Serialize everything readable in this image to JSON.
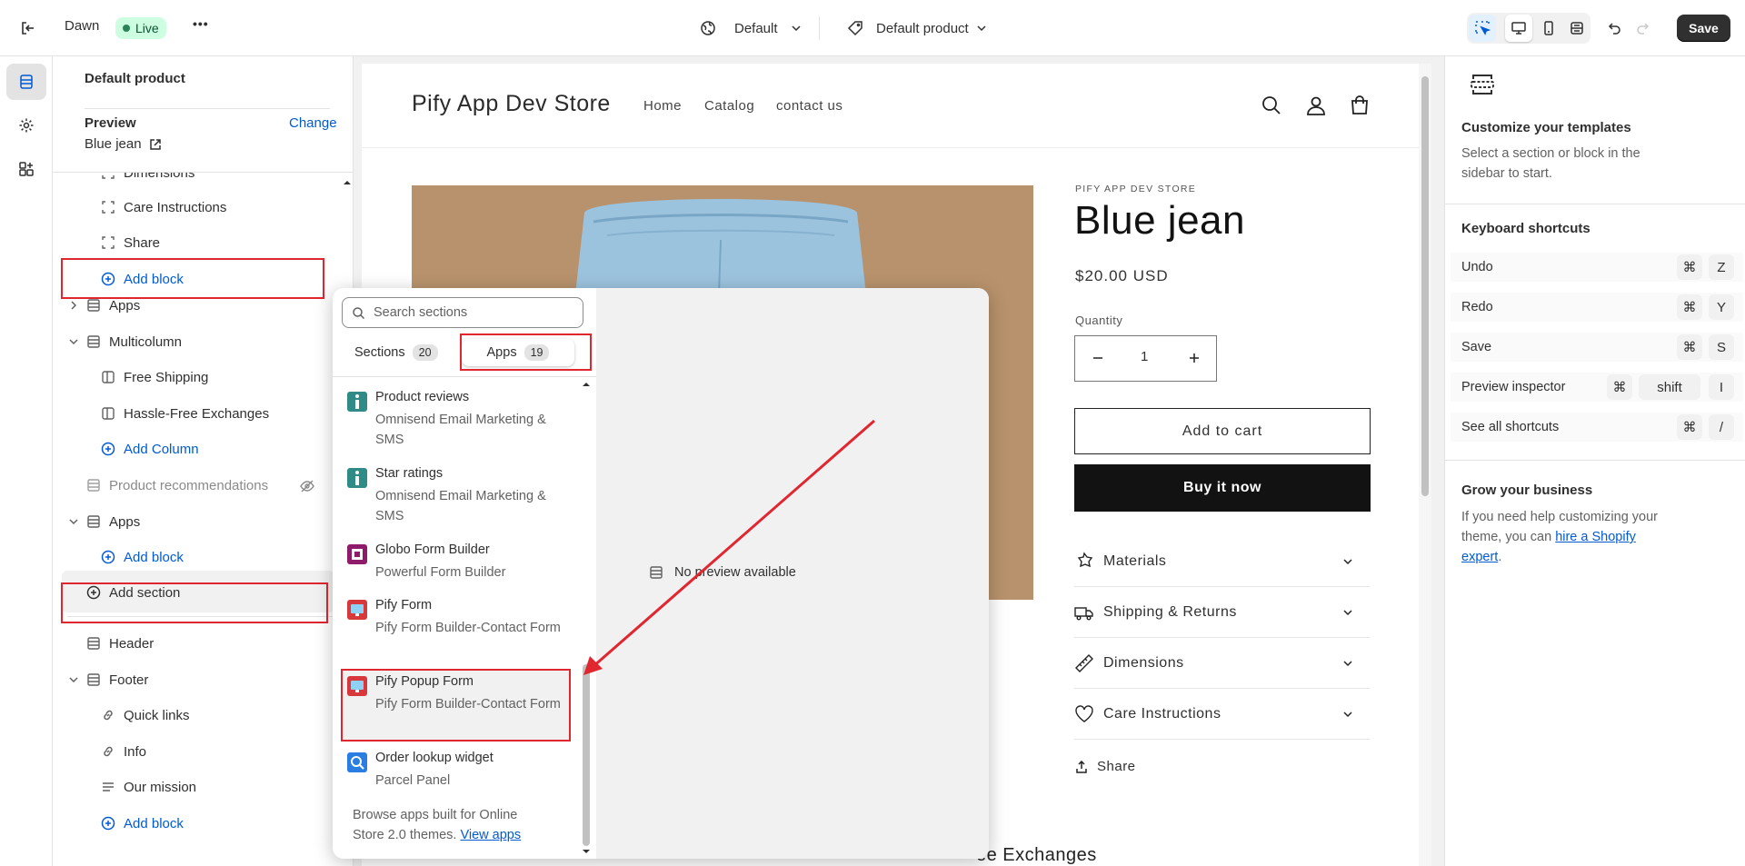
{
  "topbar": {
    "theme_name": "Dawn",
    "live_badge": "Live",
    "more": "•••",
    "market_selector": "Default",
    "template_selector": "Default product",
    "save_label": "Save"
  },
  "sidebar": {
    "title": "Default product",
    "preview_label": "Preview",
    "change_label": "Change",
    "preview_product": "Blue jean",
    "items": {
      "dimensions": "Dimensions",
      "care": "Care Instructions",
      "share": "Share",
      "add_block_1": "Add block",
      "apps_1": "Apps",
      "multicolumn": "Multicolumn",
      "free_shipping": "Free Shipping",
      "hassle_free": "Hassle-Free Exchanges",
      "add_column": "Add Column",
      "product_recs": "Product recommendations",
      "apps_2": "Apps",
      "add_block_2": "Add block",
      "add_section": "Add section",
      "header": "Header",
      "footer": "Footer",
      "quick_links": "Quick links",
      "info": "Info",
      "our_mission": "Our mission",
      "add_block_3": "Add block"
    }
  },
  "store": {
    "name": "Pify App Dev Store",
    "nav": [
      "Home",
      "Catalog",
      "contact us"
    ],
    "vendor": "PIFY APP DEV STORE",
    "product_title": "Blue jean",
    "price": "$20.00 USD",
    "quantity_label": "Quantity",
    "quantity_value": "1",
    "add_to_cart": "Add to cart",
    "buy_now": "Buy it now",
    "accordions": [
      "Materials",
      "Shipping & Returns",
      "Dimensions",
      "Care Instructions"
    ],
    "share": "Share",
    "bottom_partial": "ee Exchanges"
  },
  "picker": {
    "search_placeholder": "Search sections",
    "tab_sections": "Sections",
    "tab_sections_count": "20",
    "tab_apps": "Apps",
    "tab_apps_count": "19",
    "apps": [
      {
        "title": "Product reviews",
        "subtitle": "Omnisend Email Marketing & SMS"
      },
      {
        "title": "Star ratings",
        "subtitle": "Omnisend Email Marketing & SMS"
      },
      {
        "title": "Globo Form Builder",
        "subtitle": "Powerful Form Builder"
      },
      {
        "title": "Pify Form",
        "subtitle": "Pify Form Builder-Contact Form"
      },
      {
        "title": "Pify Popup Form",
        "subtitle": "Pify Form Builder-Contact Form"
      },
      {
        "title": "Order lookup widget",
        "subtitle": "Parcel Panel"
      }
    ],
    "browse_text": "Browse apps built for Online Store 2.0 themes.",
    "view_apps": "View apps",
    "no_preview": "No preview available"
  },
  "right": {
    "customize_title": "Customize your templates",
    "customize_desc": "Select a section or block in the sidebar to start.",
    "shortcuts_title": "Keyboard shortcuts",
    "shortcuts": [
      {
        "label": "Undo",
        "keys": [
          "⌘",
          "Z"
        ]
      },
      {
        "label": "Redo",
        "keys": [
          "⌘",
          "Y"
        ]
      },
      {
        "label": "Save",
        "keys": [
          "⌘",
          "S"
        ]
      },
      {
        "label": "Preview inspector",
        "keys": [
          "⌘",
          "shift",
          "I"
        ]
      },
      {
        "label": "See all shortcuts",
        "keys": [
          "⌘",
          "/"
        ]
      }
    ],
    "grow_title": "Grow your business",
    "grow_text": "If you need help customizing your theme, you can",
    "grow_link": "hire a Shopify expert",
    "grow_end": "."
  },
  "colors": {
    "accent_blue": "#005bd3",
    "live_green": "#cdfee1",
    "annotation_red": "#e0262e",
    "save_bg": "#303030"
  }
}
